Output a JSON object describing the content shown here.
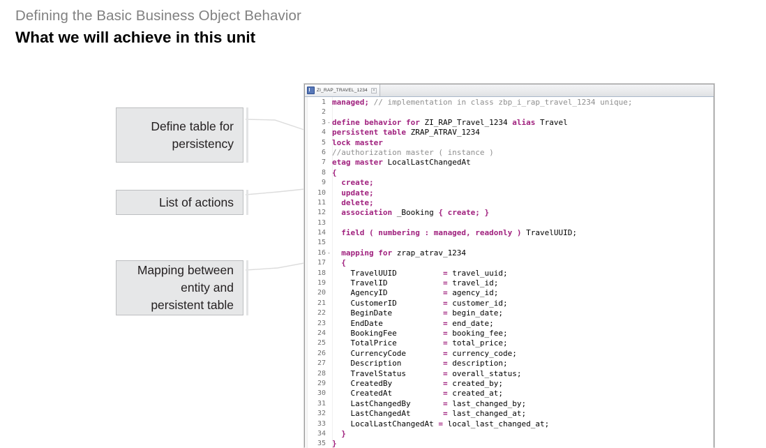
{
  "header": {
    "eyebrow": "Defining the Basic Business Object Behavior",
    "title": "What we will achieve in this unit"
  },
  "callouts": [
    {
      "id": "define-table-for-persistency",
      "label": "Define table for\npersistency"
    },
    {
      "id": "list-of-actions",
      "label": "List of actions"
    },
    {
      "id": "mapping-between-entity-and-persistent-table",
      "label": "Mapping between\nentity and\npersistent table"
    }
  ],
  "editor": {
    "tab": {
      "title": "ZI_RAP_TRAVEL_1234",
      "close_label": "×",
      "icon": "abap-document-icon"
    },
    "colors": {
      "keyword": "#A0217E",
      "comment": "#8F8F8F",
      "plain": "#000000",
      "line_number": "#707070",
      "background": "#FFFFFF"
    },
    "lines": [
      {
        "n": "1",
        "fold": "",
        "segments": [
          {
            "t": "managed;",
            "c": "kw"
          },
          {
            "t": " ",
            "c": "pl"
          },
          {
            "t": "// implementation in class zbp_i_rap_travel_1234 unique;",
            "c": "cm"
          }
        ]
      },
      {
        "n": "2",
        "fold": "",
        "segments": []
      },
      {
        "n": "3",
        "fold": "-",
        "segments": [
          {
            "t": "define behavior for",
            "c": "kw"
          },
          {
            "t": " ZI_RAP_Travel_1234 ",
            "c": "pl"
          },
          {
            "t": "alias",
            "c": "kw"
          },
          {
            "t": " Travel",
            "c": "pl"
          }
        ]
      },
      {
        "n": "4",
        "fold": "",
        "segments": [
          {
            "t": "persistent table",
            "c": "kw"
          },
          {
            "t": " ZRAP_ATRAV_1234",
            "c": "pl"
          }
        ]
      },
      {
        "n": "5",
        "fold": "",
        "segments": [
          {
            "t": "lock master",
            "c": "kw"
          }
        ]
      },
      {
        "n": "6",
        "fold": "",
        "segments": [
          {
            "t": "//authorization master ( instance )",
            "c": "cm"
          }
        ]
      },
      {
        "n": "7",
        "fold": "",
        "segments": [
          {
            "t": "etag master",
            "c": "kw"
          },
          {
            "t": " LocalLastChangedAt",
            "c": "pl"
          }
        ]
      },
      {
        "n": "8",
        "fold": "",
        "segments": [
          {
            "t": "{",
            "c": "kw"
          }
        ]
      },
      {
        "n": "9",
        "fold": "",
        "segments": [
          {
            "t": "  create;",
            "c": "kw"
          }
        ]
      },
      {
        "n": "10",
        "fold": "",
        "segments": [
          {
            "t": "  update;",
            "c": "kw"
          }
        ]
      },
      {
        "n": "11",
        "fold": "",
        "segments": [
          {
            "t": "  delete;",
            "c": "kw"
          }
        ]
      },
      {
        "n": "12",
        "fold": "",
        "segments": [
          {
            "t": "  association",
            "c": "kw"
          },
          {
            "t": " _Booking ",
            "c": "pl"
          },
          {
            "t": "{ create; }",
            "c": "kw"
          }
        ]
      },
      {
        "n": "13",
        "fold": "",
        "segments": []
      },
      {
        "n": "14",
        "fold": "",
        "segments": [
          {
            "t": "  field ( numbering : managed, readonly )",
            "c": "kw"
          },
          {
            "t": " TravelUUID;",
            "c": "pl"
          }
        ]
      },
      {
        "n": "15",
        "fold": "",
        "segments": []
      },
      {
        "n": "16",
        "fold": "-",
        "segments": [
          {
            "t": "  mapping for",
            "c": "kw"
          },
          {
            "t": " zrap_atrav_1234",
            "c": "pl"
          }
        ]
      },
      {
        "n": "17",
        "fold": "",
        "segments": [
          {
            "t": "  {",
            "c": "kw"
          }
        ]
      },
      {
        "n": "18",
        "fold": "",
        "segments": [
          {
            "t": "    TravelUUID          ",
            "c": "pl"
          },
          {
            "t": "=",
            "c": "kw"
          },
          {
            "t": " travel_uuid;",
            "c": "pl"
          }
        ]
      },
      {
        "n": "19",
        "fold": "",
        "segments": [
          {
            "t": "    TravelID            ",
            "c": "pl"
          },
          {
            "t": "=",
            "c": "kw"
          },
          {
            "t": " travel_id;",
            "c": "pl"
          }
        ]
      },
      {
        "n": "20",
        "fold": "",
        "segments": [
          {
            "t": "    AgencyID            ",
            "c": "pl"
          },
          {
            "t": "=",
            "c": "kw"
          },
          {
            "t": " agency_id;",
            "c": "pl"
          }
        ]
      },
      {
        "n": "21",
        "fold": "",
        "segments": [
          {
            "t": "    CustomerID          ",
            "c": "pl"
          },
          {
            "t": "=",
            "c": "kw"
          },
          {
            "t": " customer_id;",
            "c": "pl"
          }
        ]
      },
      {
        "n": "22",
        "fold": "",
        "segments": [
          {
            "t": "    BeginDate           ",
            "c": "pl"
          },
          {
            "t": "=",
            "c": "kw"
          },
          {
            "t": " begin_date;",
            "c": "pl"
          }
        ]
      },
      {
        "n": "23",
        "fold": "",
        "segments": [
          {
            "t": "    EndDate             ",
            "c": "pl"
          },
          {
            "t": "=",
            "c": "kw"
          },
          {
            "t": " end_date;",
            "c": "pl"
          }
        ]
      },
      {
        "n": "24",
        "fold": "",
        "segments": [
          {
            "t": "    BookingFee          ",
            "c": "pl"
          },
          {
            "t": "=",
            "c": "kw"
          },
          {
            "t": " booking_fee;",
            "c": "pl"
          }
        ]
      },
      {
        "n": "25",
        "fold": "",
        "segments": [
          {
            "t": "    TotalPrice          ",
            "c": "pl"
          },
          {
            "t": "=",
            "c": "kw"
          },
          {
            "t": " total_price;",
            "c": "pl"
          }
        ]
      },
      {
        "n": "26",
        "fold": "",
        "segments": [
          {
            "t": "    CurrencyCode        ",
            "c": "pl"
          },
          {
            "t": "=",
            "c": "kw"
          },
          {
            "t": " currency_code;",
            "c": "pl"
          }
        ]
      },
      {
        "n": "27",
        "fold": "",
        "segments": [
          {
            "t": "    Description         ",
            "c": "pl"
          },
          {
            "t": "=",
            "c": "kw"
          },
          {
            "t": " description;",
            "c": "pl"
          }
        ]
      },
      {
        "n": "28",
        "fold": "",
        "segments": [
          {
            "t": "    TravelStatus        ",
            "c": "pl"
          },
          {
            "t": "=",
            "c": "kw"
          },
          {
            "t": " overall_status;",
            "c": "pl"
          }
        ]
      },
      {
        "n": "29",
        "fold": "",
        "segments": [
          {
            "t": "    CreatedBy           ",
            "c": "pl"
          },
          {
            "t": "=",
            "c": "kw"
          },
          {
            "t": " created_by;",
            "c": "pl"
          }
        ]
      },
      {
        "n": "30",
        "fold": "",
        "segments": [
          {
            "t": "    CreatedAt           ",
            "c": "pl"
          },
          {
            "t": "=",
            "c": "kw"
          },
          {
            "t": " created_at;",
            "c": "pl"
          }
        ]
      },
      {
        "n": "31",
        "fold": "",
        "segments": [
          {
            "t": "    LastChangedBy       ",
            "c": "pl"
          },
          {
            "t": "=",
            "c": "kw"
          },
          {
            "t": " last_changed_by;",
            "c": "pl"
          }
        ]
      },
      {
        "n": "32",
        "fold": "",
        "segments": [
          {
            "t": "    LastChangedAt       ",
            "c": "pl"
          },
          {
            "t": "=",
            "c": "kw"
          },
          {
            "t": " last_changed_at;",
            "c": "pl"
          }
        ]
      },
      {
        "n": "33",
        "fold": "",
        "segments": [
          {
            "t": "    LocalLastChangedAt ",
            "c": "pl"
          },
          {
            "t": "=",
            "c": "kw"
          },
          {
            "t": " local_last_changed_at;",
            "c": "pl"
          }
        ]
      },
      {
        "n": "34",
        "fold": "",
        "segments": [
          {
            "t": "  }",
            "c": "kw"
          }
        ]
      },
      {
        "n": "35",
        "fold": "",
        "segments": [
          {
            "t": "}",
            "c": "kw"
          }
        ]
      }
    ]
  }
}
